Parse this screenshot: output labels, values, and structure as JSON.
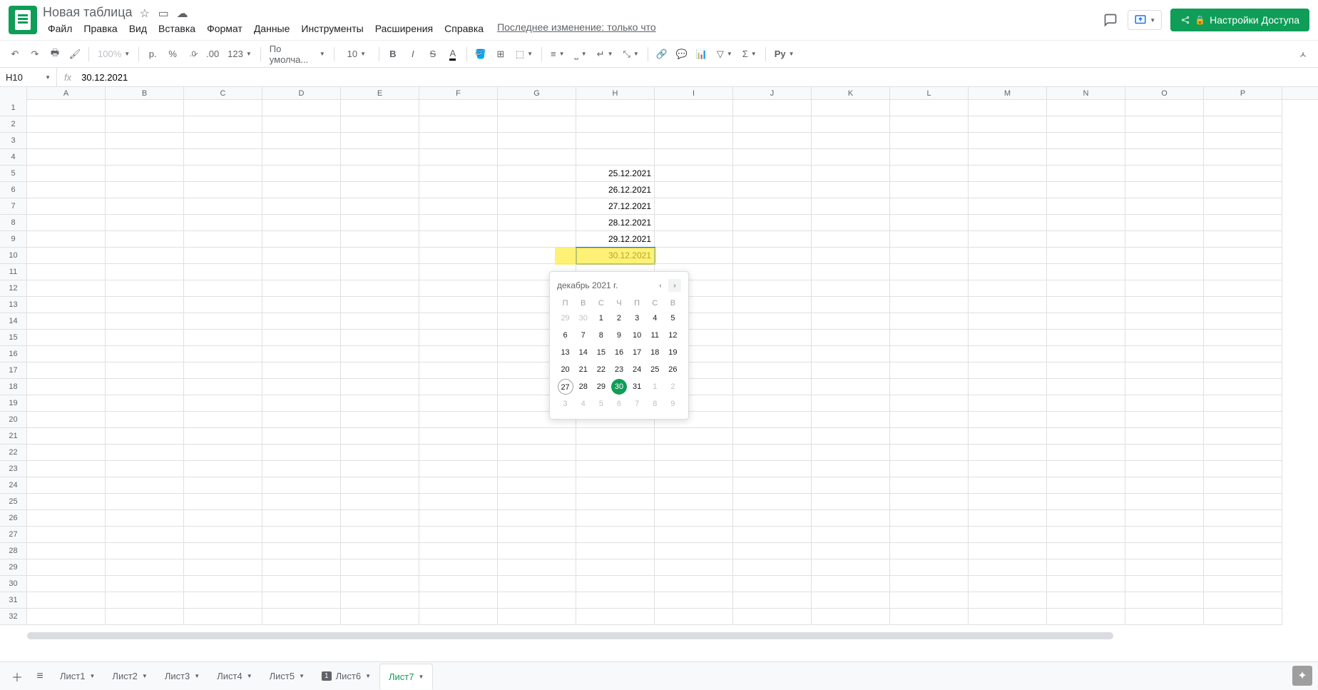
{
  "doc": {
    "title": "Новая таблица"
  },
  "menu": {
    "file": "Файл",
    "edit": "Правка",
    "view": "Вид",
    "insert": "Вставка",
    "format": "Формат",
    "data": "Данные",
    "tools": "Инструменты",
    "extensions": "Расширения",
    "help": "Справка",
    "last_edit": "Последнее изменение: только что"
  },
  "share": {
    "label": "Настройки Доступа"
  },
  "toolbar": {
    "zoom": "100%",
    "currency": "р.",
    "percent": "%",
    "dec_dec": ".0",
    "dec_inc": ".00",
    "num_format": "123",
    "font": "По умолча...",
    "font_size": "10",
    "py_label": "Py"
  },
  "name_box": "H10",
  "formula": "30.12.2021",
  "columns": [
    "A",
    "B",
    "C",
    "D",
    "E",
    "F",
    "G",
    "H",
    "I",
    "J",
    "K",
    "L",
    "M",
    "N",
    "O",
    "P"
  ],
  "rows_visible": 32,
  "selected_cell": {
    "row": 10,
    "col": "H"
  },
  "cell_data": {
    "H5": "25.12.2021",
    "H6": "26.12.2021",
    "H7": "27.12.2021",
    "H8": "28.12.2021",
    "H9": "29.12.2021",
    "H10": "30.12.2021"
  },
  "datepicker": {
    "title": "декабрь 2021 г.",
    "dow": [
      "П",
      "В",
      "С",
      "Ч",
      "П",
      "С",
      "В"
    ],
    "weeks": [
      [
        {
          "d": 29,
          "o": true
        },
        {
          "d": 30,
          "o": true
        },
        {
          "d": 1
        },
        {
          "d": 2
        },
        {
          "d": 3
        },
        {
          "d": 4
        },
        {
          "d": 5
        }
      ],
      [
        {
          "d": 6
        },
        {
          "d": 7
        },
        {
          "d": 8
        },
        {
          "d": 9
        },
        {
          "d": 10
        },
        {
          "d": 11
        },
        {
          "d": 12
        }
      ],
      [
        {
          "d": 13
        },
        {
          "d": 14
        },
        {
          "d": 15
        },
        {
          "d": 16
        },
        {
          "d": 17
        },
        {
          "d": 18
        },
        {
          "d": 19
        }
      ],
      [
        {
          "d": 20
        },
        {
          "d": 21
        },
        {
          "d": 22
        },
        {
          "d": 23
        },
        {
          "d": 24
        },
        {
          "d": 25
        },
        {
          "d": 26
        }
      ],
      [
        {
          "d": 27,
          "today": true
        },
        {
          "d": 28
        },
        {
          "d": 29
        },
        {
          "d": 30,
          "sel": true
        },
        {
          "d": 31
        },
        {
          "d": 1,
          "o": true
        },
        {
          "d": 2,
          "o": true
        }
      ],
      [
        {
          "d": 3,
          "o": true
        },
        {
          "d": 4,
          "o": true
        },
        {
          "d": 5,
          "o": true
        },
        {
          "d": 6,
          "o": true
        },
        {
          "d": 7,
          "o": true
        },
        {
          "d": 8,
          "o": true
        },
        {
          "d": 9,
          "o": true
        }
      ]
    ]
  },
  "sheets": [
    {
      "name": "Лист1"
    },
    {
      "name": "Лист2"
    },
    {
      "name": "Лист3"
    },
    {
      "name": "Лист4"
    },
    {
      "name": "Лист5"
    },
    {
      "name": "Лист6",
      "badge": "1"
    },
    {
      "name": "Лист7",
      "active": true
    }
  ]
}
